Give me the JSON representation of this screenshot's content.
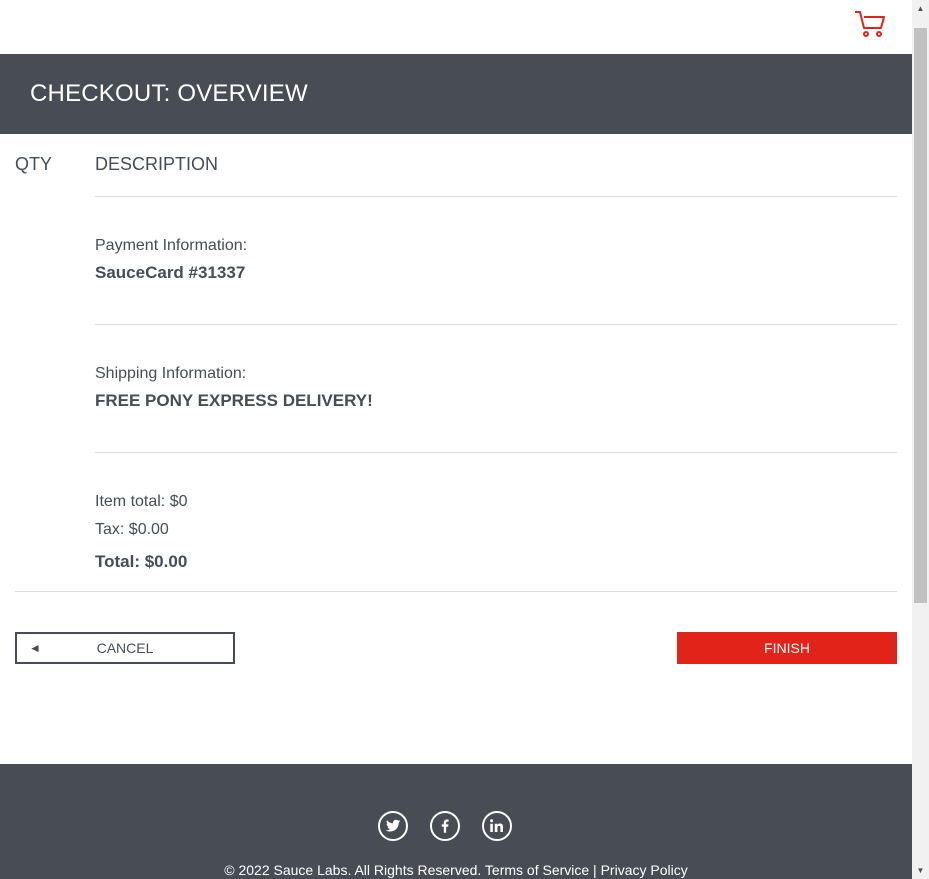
{
  "header": {
    "title": "CHECKOUT: OVERVIEW"
  },
  "topbar": {
    "cart_icon": "shopping-cart-icon",
    "cart_color": "#e2231a"
  },
  "columns": {
    "qty": "QTY",
    "description": "DESCRIPTION"
  },
  "payment": {
    "label": "Payment Information:",
    "value": "SauceCard #31337"
  },
  "shipping": {
    "label": "Shipping Information:",
    "value": "FREE PONY EXPRESS DELIVERY!"
  },
  "totals": {
    "item_total": "Item total: $0",
    "tax": "Tax: $0.00",
    "total": "Total: $0.00"
  },
  "buttons": {
    "cancel": "CANCEL",
    "cancel_icon": "◄",
    "finish": "FINISH"
  },
  "footer": {
    "copyright": "© 2022 Sauce Labs. All Rights Reserved. Terms of Service | Privacy Policy",
    "social_icons": [
      "twitter-icon",
      "facebook-icon",
      "linkedin-icon"
    ]
  },
  "colors": {
    "accent": "#e2231a",
    "dark": "#474c55"
  }
}
